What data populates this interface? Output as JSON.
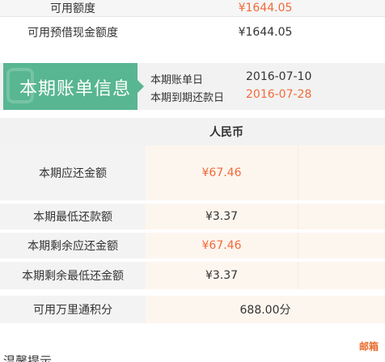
{
  "summary": {
    "available_credit_label": "可用额度",
    "available_credit_value": "¥1644.05",
    "available_cash_label": "可用预借现金额度",
    "available_cash_value": "¥1644.05"
  },
  "statement": {
    "title": "本期账单信息",
    "bill_date_label": "本期账单日",
    "bill_date_value": "2016-07-10",
    "due_date_label": "本期到期还款日",
    "due_date_value": "2016-07-28"
  },
  "currency": "人民币",
  "rows": [
    {
      "label": "本期应还金额",
      "value": "¥67.46"
    },
    {
      "label": "本期最低还款额",
      "value": "¥3.37"
    },
    {
      "label": "本期剩余应还金额",
      "value": "¥67.46"
    },
    {
      "label": "本期剩余最低还金额",
      "value": "¥3.37"
    }
  ],
  "points": {
    "label": "可用万里通积分",
    "value": "688.00分"
  },
  "footer": {
    "mail_link": "邮箱",
    "tips_heading": "温馨提示"
  },
  "colors": {
    "accent_green": "#58b692",
    "highlight_orange": "#f26a3a"
  }
}
